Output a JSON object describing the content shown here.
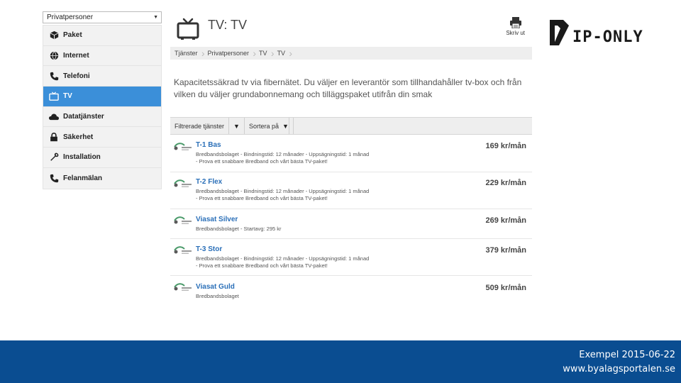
{
  "sidebar": {
    "select_value": "Privatpersoner",
    "items": [
      {
        "label": "Paket",
        "icon": "box-icon",
        "active": false
      },
      {
        "label": "Internet",
        "icon": "globe-icon",
        "active": false
      },
      {
        "label": "Telefoni",
        "icon": "phone-icon",
        "active": false
      },
      {
        "label": "TV",
        "icon": "tv-icon",
        "active": true
      },
      {
        "label": "Datatjänster",
        "icon": "cloud-icon",
        "active": false
      },
      {
        "label": "Säkerhet",
        "icon": "lock-icon",
        "active": false
      },
      {
        "label": "Installation",
        "icon": "wrench-icon",
        "active": false
      },
      {
        "label": "Felanmälan",
        "icon": "phone-icon",
        "active": false
      }
    ]
  },
  "header": {
    "title": "TV: TV",
    "print_label": "Skriv ut"
  },
  "breadcrumb": [
    "Tjänster",
    "Privatpersoner",
    "TV",
    "TV"
  ],
  "intro": "Kapacitetssäkrad tv via fibernätet. Du väljer en leverantör som tillhandahåller tv-box och från vilken du väljer grundabonnemang och tilläggspaket utifrån din smak",
  "filters": {
    "filter_label": "Filtrerade tjänster",
    "sort_label": "Sortera på"
  },
  "services": [
    {
      "name": "T-1 Bas",
      "desc1": "Bredbandsbolaget - Bindningstid: 12 månader - Uppsägningstid: 1 månad",
      "desc2": "- Prova ett snabbare Bredband och vårt bästa TV-paket!",
      "price": "169 kr/mån"
    },
    {
      "name": "T-2 Flex",
      "desc1": "Bredbandsbolaget - Bindningstid: 12 månader - Uppsägningstid: 1 månad",
      "desc2": "- Prova ett snabbare Bredband och vårt bästa TV-paket!",
      "price": "229 kr/mån"
    },
    {
      "name": "Viasat Silver",
      "desc1": "Bredbandsbolaget - Startavg: 295 kr",
      "desc2": "",
      "price": "269 kr/mån"
    },
    {
      "name": "T-3 Stor",
      "desc1": "Bredbandsbolaget - Bindningstid: 12 månader - Uppsägningstid: 1 månad",
      "desc2": "- Prova ett snabbare Bredband och vårt bästa TV-paket!",
      "price": "379 kr/mån"
    },
    {
      "name": "Viasat Guld",
      "desc1": "Bredbandsbolaget",
      "desc2": "",
      "price": "509 kr/mån"
    }
  ],
  "brand": {
    "name": "IP-ONLY"
  },
  "footer": {
    "line1": "Exempel 2015-06-22",
    "line2": "www.byalagsportalen.se"
  },
  "colors": {
    "accent": "#3b8fd9",
    "footer": "#0a4d91",
    "link": "#2a6fb8"
  }
}
